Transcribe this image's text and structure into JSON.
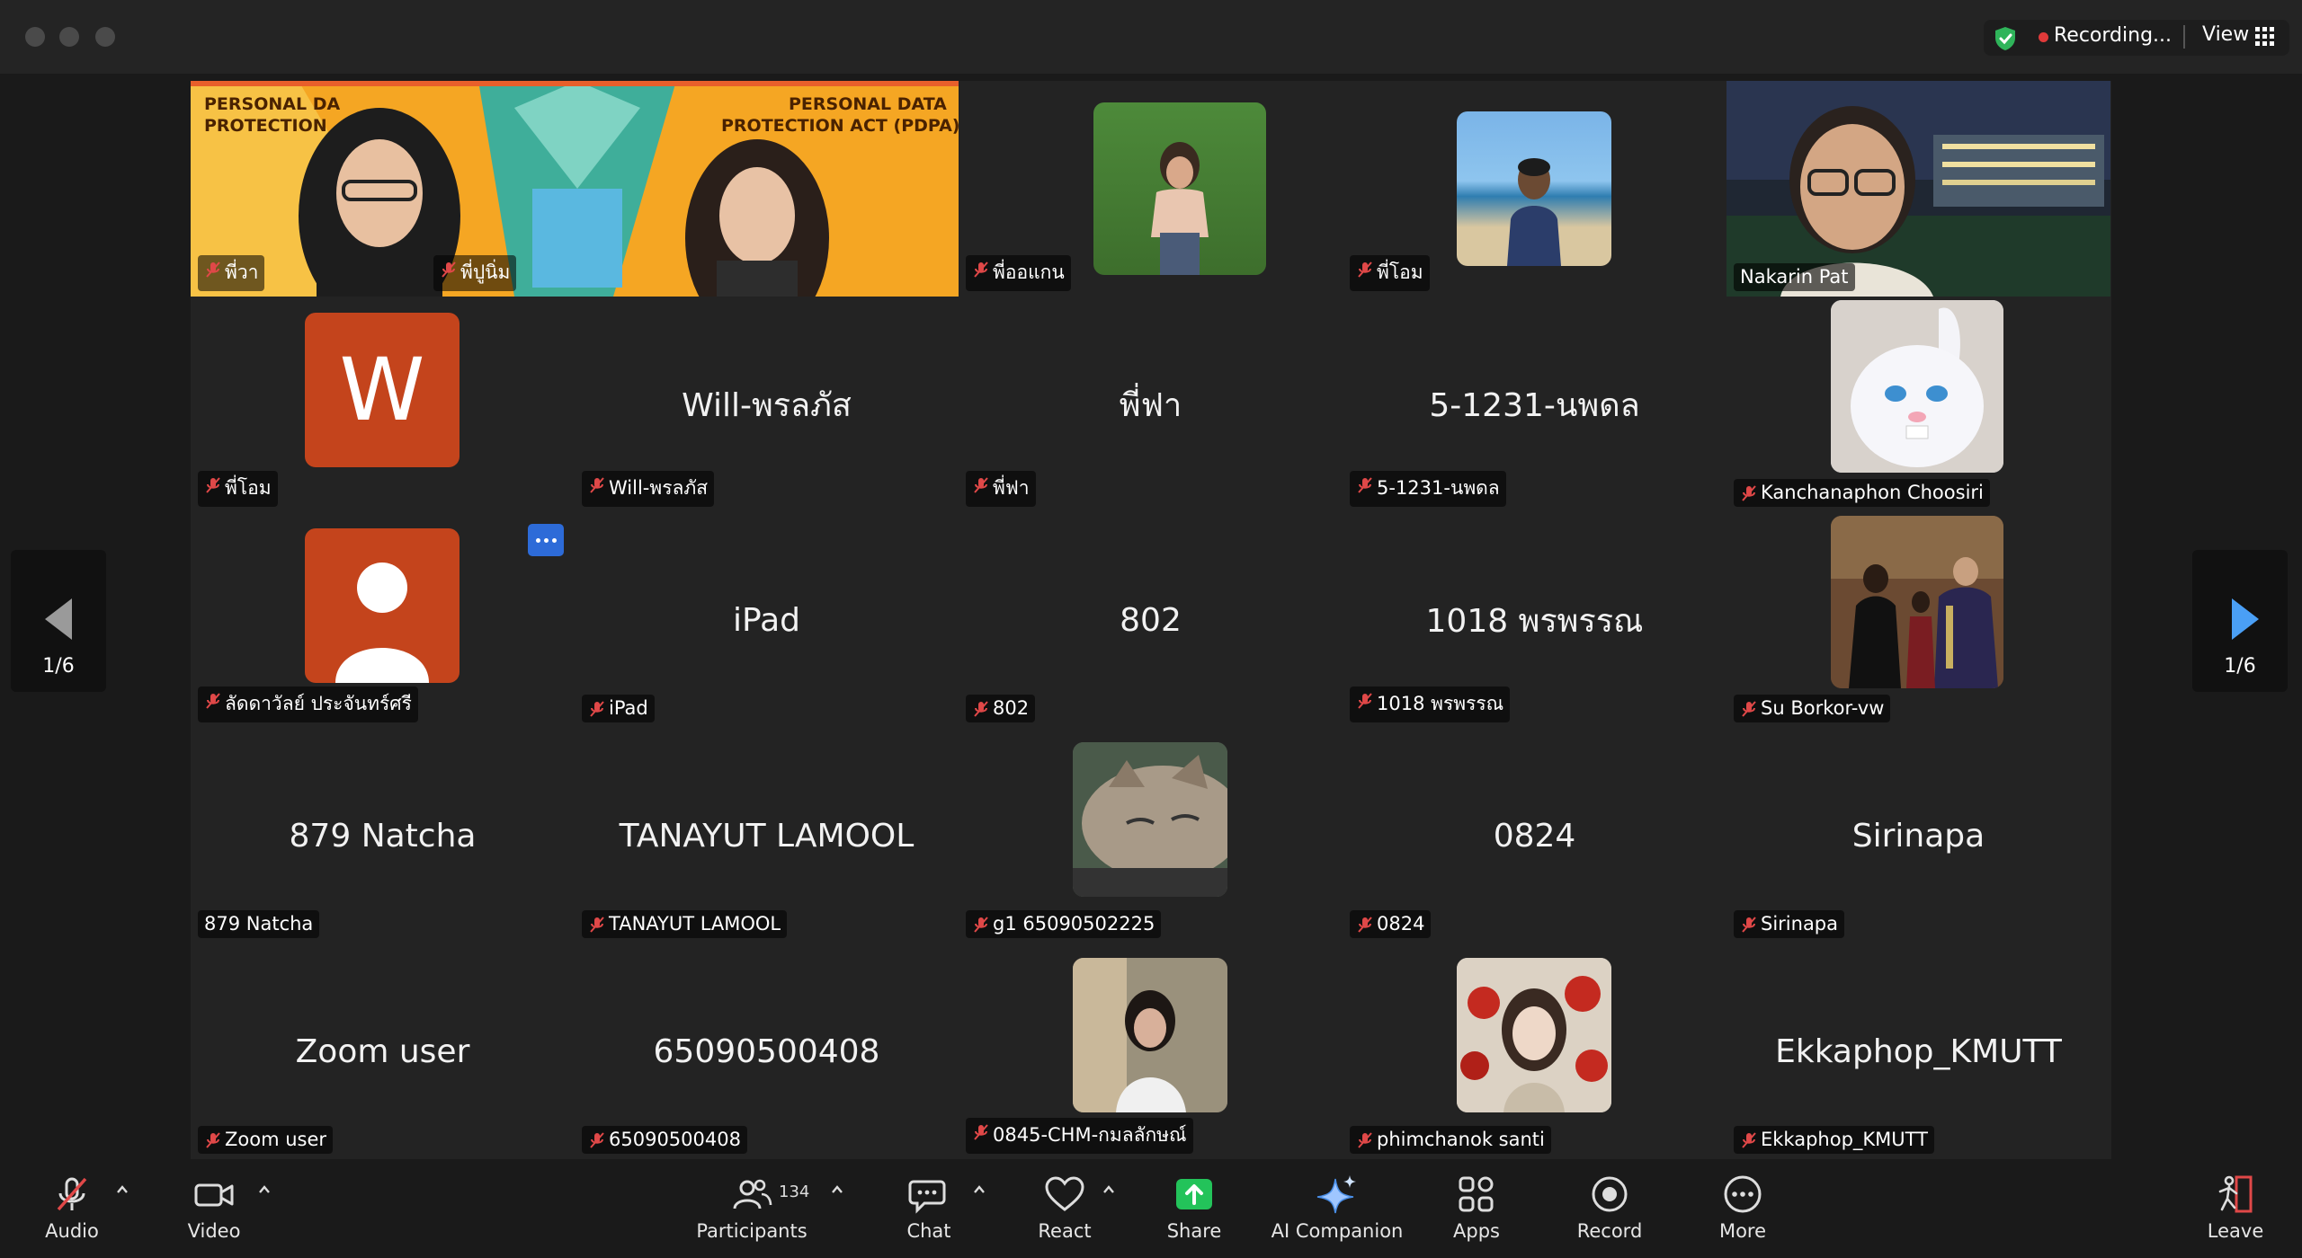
{
  "window": {
    "recording_label": "Recording...",
    "view_label": "View"
  },
  "gallery": {
    "page_indicator": "1/6",
    "tiles": [
      {
        "name": "พี่วา",
        "muted": true,
        "type": "video"
      },
      {
        "name": "พี่ปูนิ่ม",
        "muted": true,
        "type": "video"
      },
      {
        "name": "พี่ออแกน",
        "muted": true,
        "type": "photo"
      },
      {
        "name": "พี่โอม",
        "muted": true,
        "type": "photo"
      },
      {
        "name": "Nakarin Pat",
        "muted": false,
        "type": "video",
        "active": true
      },
      {
        "name": "พี่โอม",
        "muted": true,
        "type": "letter",
        "letter": "W",
        "avatar_color": "#c4441c"
      },
      {
        "name": "Will-พรลภัส",
        "display": "Will-พรลภัส",
        "muted": true,
        "type": "text"
      },
      {
        "name": "พี่ฟา",
        "display": "พี่ฟา",
        "muted": true,
        "type": "text"
      },
      {
        "name": "5-1231-นพดล",
        "display": "5-1231-นพดล",
        "muted": true,
        "type": "text"
      },
      {
        "name": "Kanchanaphon Choosiri",
        "muted": true,
        "type": "photo"
      },
      {
        "name": "ลัดดาวัลย์ ประจันทร์ศรี",
        "muted": true,
        "type": "person-avatar",
        "avatar_color": "#c4441c"
      },
      {
        "name": "iPad",
        "display": "iPad",
        "muted": true,
        "type": "text"
      },
      {
        "name": "802",
        "display": "802",
        "muted": true,
        "type": "text"
      },
      {
        "name": "1018 พรพรรณ",
        "display": "1018 พรพรรณ",
        "muted": true,
        "type": "text"
      },
      {
        "name": "Su Borkor-vw",
        "muted": true,
        "type": "photo"
      },
      {
        "name": "879 Natcha",
        "display": "879 Natcha",
        "muted": false,
        "type": "text"
      },
      {
        "name": "TANAYUT LAMOOL",
        "display": "TANAYUT LAMOOL",
        "muted": true,
        "type": "text"
      },
      {
        "name": "g1 65090502225",
        "muted": true,
        "type": "photo"
      },
      {
        "name": "0824",
        "display": "0824",
        "muted": true,
        "type": "text"
      },
      {
        "name": "Sirinapa",
        "display": "Sirinapa",
        "muted": true,
        "type": "text"
      },
      {
        "name": "Zoom user",
        "display": "Zoom user",
        "muted": true,
        "type": "text"
      },
      {
        "name": "65090500408",
        "display": "65090500408",
        "muted": true,
        "type": "text"
      },
      {
        "name": "0845-CHM-กมลลักษณ์",
        "muted": true,
        "type": "photo"
      },
      {
        "name": "phimchanok santi",
        "muted": true,
        "type": "photo"
      },
      {
        "name": "Ekkaphop_KMUTT",
        "display": "Ekkaphop_KMUTT",
        "muted": true,
        "type": "text"
      }
    ],
    "banner": {
      "left_title": "PERSONAL DA\nPROTECTION",
      "right_title": "PERSONAL DATA\nPROTECTION ACT (PDPA)"
    }
  },
  "toolbar": {
    "audio": "Audio",
    "video": "Video",
    "participants": "Participants",
    "participants_count": "134",
    "chat": "Chat",
    "react": "React",
    "share": "Share",
    "ai_companion": "AI Companion",
    "apps": "Apps",
    "record": "Record",
    "more": "More",
    "leave": "Leave"
  },
  "colors": {
    "active_speaker": "#5bd158",
    "share_green": "#23c35a",
    "record_red": "#e03a3a",
    "nav_arrow": "#4a9ff5",
    "avatar_orange": "#c4441c"
  }
}
